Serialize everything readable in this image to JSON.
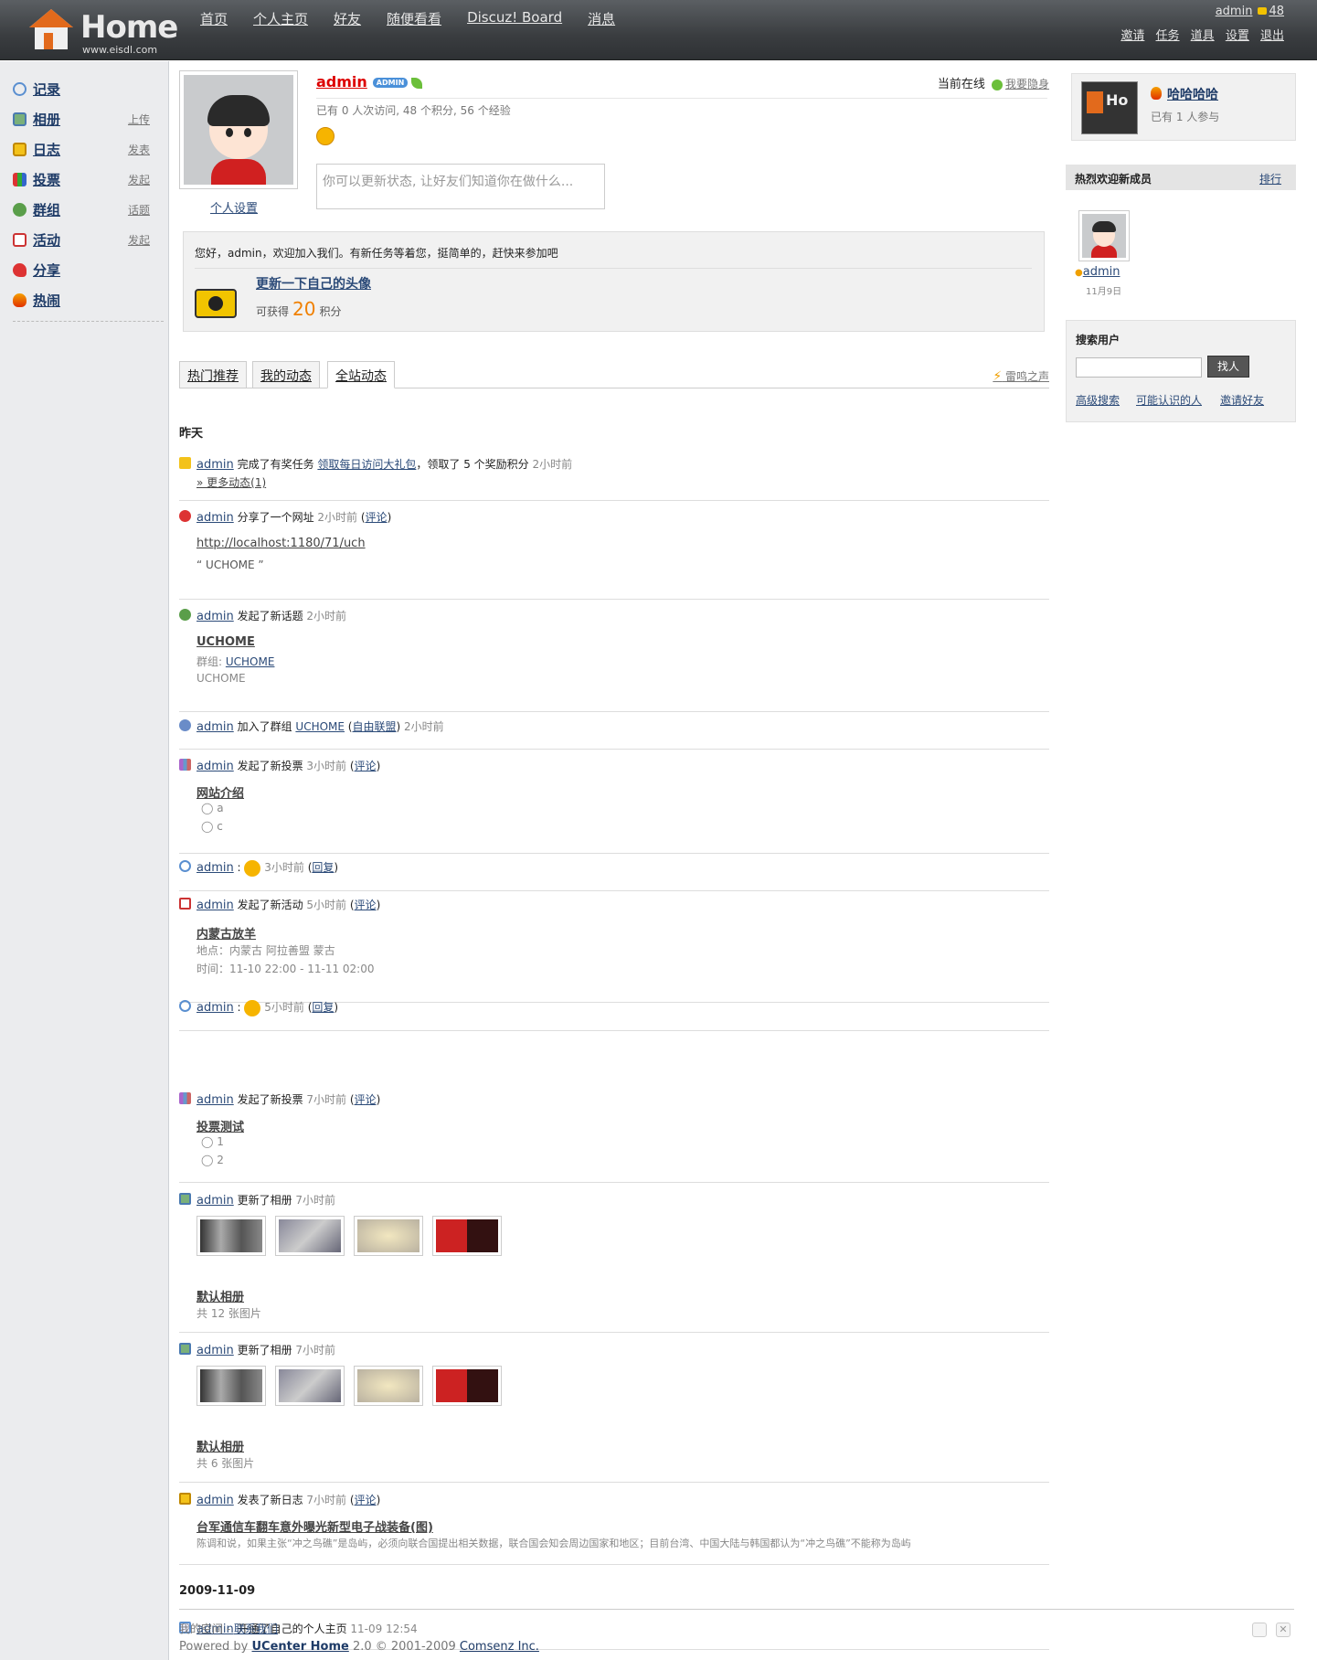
{
  "brand": {
    "name": "Home",
    "site": "www.eisdl.com"
  },
  "nav": [
    "首页",
    "个人主页",
    "好友",
    "随便看看",
    "Discuz! Board",
    "消息"
  ],
  "topright": {
    "user": "admin",
    "credits": "48",
    "links": [
      "邀请",
      "任务",
      "道具",
      "设置",
      "退出"
    ]
  },
  "sidebar": {
    "items": [
      {
        "label": "记录",
        "action": ""
      },
      {
        "label": "相册",
        "action": "上传"
      },
      {
        "label": "日志",
        "action": "发表"
      },
      {
        "label": "投票",
        "action": "发起"
      },
      {
        "label": "群组",
        "action": "话题"
      },
      {
        "label": "活动",
        "action": "发起"
      },
      {
        "label": "分享",
        "action": ""
      },
      {
        "label": "热闹",
        "action": ""
      }
    ]
  },
  "profile": {
    "name": "admin",
    "badge": "ADMIN",
    "settings": "个人设置",
    "online_label": "当前在线",
    "hide": "我要隐身",
    "stats": "已有 0 人次访问, 48 个积分, 56 个经验",
    "status_placeholder": "你可以更新状态, 让好友们知道你在做什么..."
  },
  "welcome": {
    "text": "您好，admin，欢迎加入我们。有新任务等着您，挺简单的，赶快来参加吧",
    "task": "更新一下自己的头像",
    "get": "可获得",
    "points": "20",
    "unit": "积分"
  },
  "tabs": {
    "items": [
      "热门推荐",
      "我的动态",
      "全站动态"
    ],
    "right": "雷鸣之声"
  },
  "feed": {
    "day1": "昨天",
    "day2": "2009-11-09",
    "f1": {
      "user": "admin",
      "t1": "完成了有奖任务",
      "link": "领取每日访问大礼包",
      "t2": "，领取了 5 个奖励积分",
      "time": "2小时前",
      "more": "» 更多动态(1)"
    },
    "f2": {
      "user": "admin",
      "t1": "分享了一个网址",
      "time": "2小时前",
      "c": "评论",
      "url": "http://localhost:1180/71/uch",
      "quote": "UCHOME"
    },
    "f3": {
      "user": "admin",
      "t1": "发起了新话题",
      "time": "2小时前",
      "title": "UCHOME",
      "group_label": "群组:",
      "group": "UCHOME",
      "desc": "UCHOME"
    },
    "f4": {
      "user": "admin",
      "t1": "加入了群组",
      "group": "UCHOME",
      "sub": "自由联盟",
      "time": "2小时前"
    },
    "f5": {
      "user": "admin",
      "t1": "发起了新投票",
      "time": "3小时前",
      "c": "评论",
      "title": "网站介绍",
      "opts": [
        "a",
        "c"
      ]
    },
    "f6": {
      "user": "admin",
      "time": "3小时前",
      "c": "回复"
    },
    "f7": {
      "user": "admin",
      "t1": "发起了新活动",
      "time": "5小时前",
      "c": "评论",
      "title": "内蒙古放羊",
      "place": "地点：内蒙古 阿拉善盟 蒙古",
      "when": "时间：11-10 22:00 - 11-11 02:00"
    },
    "f8": {
      "user": "admin",
      "time": "5小时前",
      "c": "回复"
    },
    "f9": {
      "user": "admin",
      "t1": "发起了新投票",
      "time": "7小时前",
      "c": "评论",
      "title": "投票测试",
      "opts": [
        "1",
        "2"
      ]
    },
    "f10": {
      "user": "admin",
      "t1": "更新了相册",
      "time": "7小时前",
      "album": "默认相册",
      "count": "共 12 张图片"
    },
    "f11": {
      "user": "admin",
      "t1": "更新了相册",
      "time": "7小时前",
      "album": "默认相册",
      "count": "共 6 张图片"
    },
    "f12": {
      "user": "admin",
      "t1": "发表了新日志",
      "time": "7小时前",
      "c": "评论",
      "title": "台军通信车翻车意外曝光新型电子战装备(图)",
      "excerpt": "陈调和说，如果主张“冲之鸟礁”是岛屿，必须向联合国提出相关数据，联合国会知会周边国家和地区；目前台湾、中国大陆与韩国都认为“冲之鸟礁”不能称为岛屿"
    },
    "f13": {
      "user": "admin",
      "t1": "开通了自己的个人主页",
      "time": "11-09 12:54"
    }
  },
  "right": {
    "hot": {
      "title": "哈哈哈哈",
      "count": "已有 1 人参与"
    },
    "newmembers": {
      "title": "热烈欢迎新成员",
      "rank": "排行",
      "user": "admin",
      "date": "11月9日"
    },
    "search": {
      "title": "搜索用户",
      "button": "找人",
      "links": [
        "高级搜索",
        "可能认识的人",
        "邀请好友"
      ]
    }
  },
  "footer": {
    "l1a": "我的空间",
    "l1b": "联系我们",
    "powered": "Powered by",
    "product": "UCenter Home",
    "ver": "2.0 © 2001-2009",
    "company": "Comsenz Inc."
  }
}
